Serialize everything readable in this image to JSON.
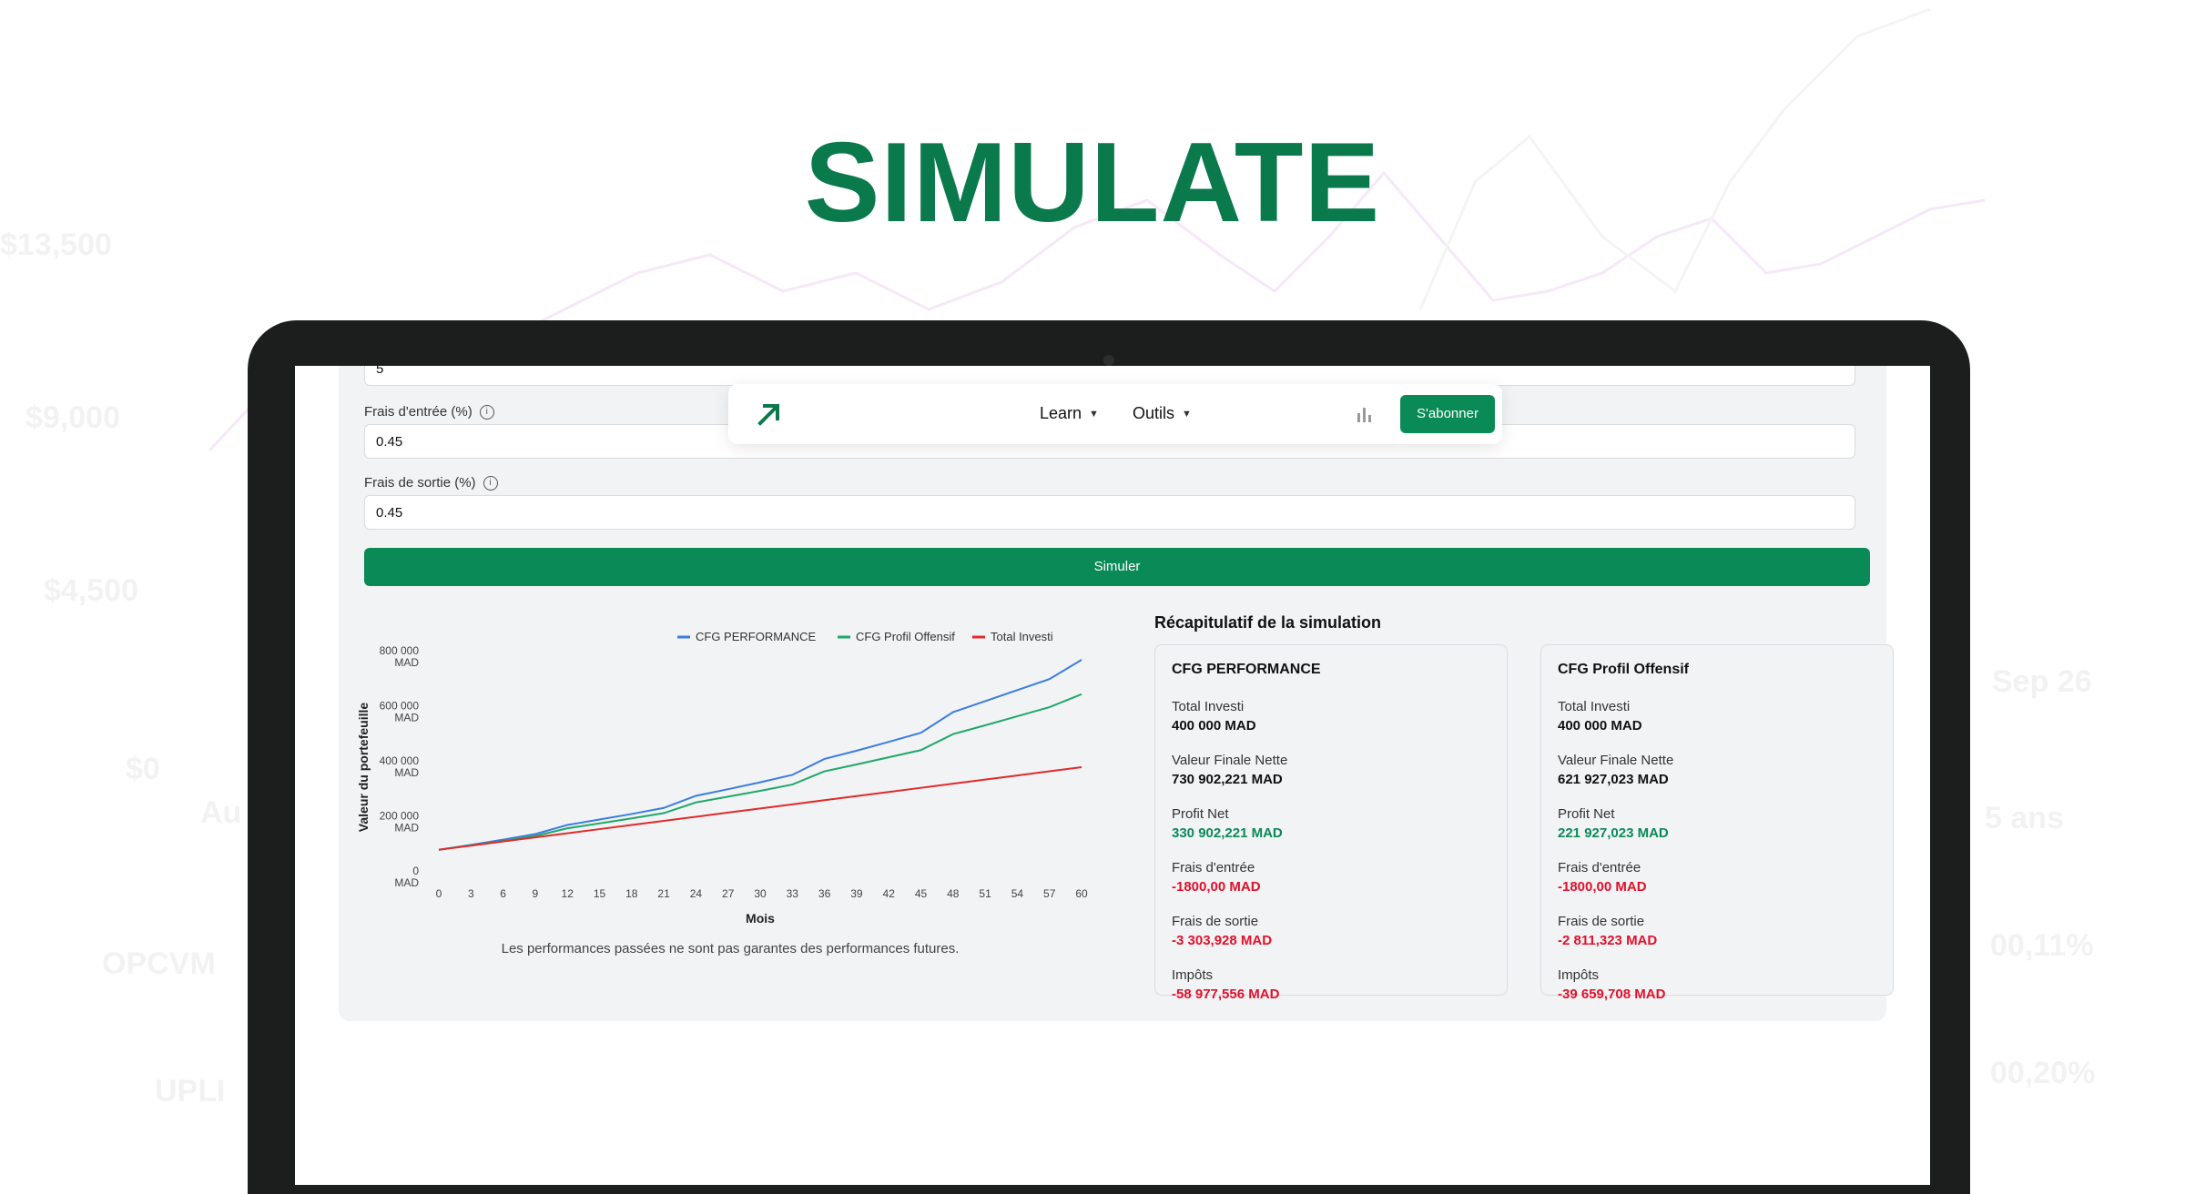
{
  "hero": {
    "title": "SIMULATE"
  },
  "background": {
    "labels": [
      "$13,500",
      "$9,000",
      "$4,500",
      "$0",
      "Au",
      "OPCVM",
      "UPLI",
      "Sep 26",
      "5 ans",
      "00,11%",
      "00,20%"
    ]
  },
  "navbar": {
    "logo_icon": "arrow-up-right-icon",
    "menu": [
      {
        "label": "Learn",
        "icon": "chevron-down-icon"
      },
      {
        "label": "Outils",
        "icon": "chevron-down-icon"
      }
    ],
    "chart_icon": "bar-chart-icon",
    "cta_label": "S'abonner"
  },
  "form": {
    "first_value": "5",
    "fields": [
      {
        "label": "Frais d'entrée (%)",
        "value": "0.45"
      },
      {
        "label": "Frais de sortie (%)",
        "value": "0.45"
      }
    ],
    "submit_label": "Simuler"
  },
  "colors": {
    "accent": "#0a8a57",
    "title": "#0a7a4c",
    "blue": "#3a7de0",
    "green": "#1fa86a",
    "red": "#e02b2b"
  },
  "chart_data": {
    "type": "line",
    "title": "",
    "xlabel": "Mois",
    "ylabel": "Valeur du portefeuille",
    "x": [
      0,
      3,
      6,
      9,
      12,
      15,
      18,
      21,
      24,
      27,
      30,
      33,
      36,
      39,
      42,
      45,
      48,
      51,
      54,
      57,
      60
    ],
    "x_ticks": [
      "0",
      "3",
      "6",
      "9",
      "12",
      "15",
      "18",
      "21",
      "24",
      "27",
      "30",
      "33",
      "36",
      "39",
      "42",
      "45",
      "48",
      "51",
      "54",
      "57",
      "60"
    ],
    "y_ticks": [
      {
        "value": 0,
        "label": "0 MAD"
      },
      {
        "value": 200000,
        "label": "200 000 MAD"
      },
      {
        "value": 400000,
        "label": "400 000 MAD"
      },
      {
        "value": 600000,
        "label": "600 000 MAD"
      },
      {
        "value": 800000,
        "label": "800 000 MAD"
      }
    ],
    "ylim": [
      0,
      800000
    ],
    "legend_position": "top-right",
    "series": [
      {
        "name": "CFG PERFORMANCE",
        "color": "#3a7de0",
        "values": [
          100000,
          118000,
          137000,
          157000,
          190000,
          210000,
          230000,
          252000,
          296000,
          320000,
          345000,
          372000,
          430000,
          460000,
          492000,
          525000,
          600000,
          640000,
          680000,
          720000,
          790000
        ]
      },
      {
        "name": "CFG Profil Offensif",
        "color": "#1fa86a",
        "values": [
          100000,
          116000,
          132000,
          150000,
          178000,
          196000,
          214000,
          233000,
          272000,
          293000,
          314000,
          337000,
          385000,
          410000,
          436000,
          462000,
          520000,
          552000,
          585000,
          618000,
          665000
        ]
      },
      {
        "name": "Total Investi",
        "color": "#e02b2b",
        "values": [
          100000,
          115000,
          130000,
          145000,
          160000,
          175000,
          190000,
          205000,
          220000,
          235000,
          250000,
          265000,
          280000,
          295000,
          310000,
          325000,
          340000,
          355000,
          370000,
          385000,
          400000
        ]
      }
    ]
  },
  "disclaimer": "Les performances passées ne sont pas garantes des performances futures.",
  "summary": {
    "title": "Récapitulatif de la simulation",
    "cards": [
      {
        "title": "CFG PERFORMANCE",
        "rows": [
          {
            "label": "Total Investi",
            "value": "400 000 MAD",
            "kind": "neutral"
          },
          {
            "label": "Valeur Finale Nette",
            "value": "730 902,221 MAD",
            "kind": "neutral"
          },
          {
            "label": "Profit Net",
            "value": "330 902,221 MAD",
            "kind": "pos"
          },
          {
            "label": "Frais d'entrée",
            "value": "-1800,00 MAD",
            "kind": "neg"
          },
          {
            "label": "Frais de sortie",
            "value": "-3 303,928 MAD",
            "kind": "neg"
          },
          {
            "label": "Impôts",
            "value": "-58 977,556 MAD",
            "kind": "neg"
          }
        ]
      },
      {
        "title": "CFG Profil Offensif",
        "rows": [
          {
            "label": "Total Investi",
            "value": "400 000 MAD",
            "kind": "neutral"
          },
          {
            "label": "Valeur Finale Nette",
            "value": "621 927,023 MAD",
            "kind": "neutral"
          },
          {
            "label": "Profit Net",
            "value": "221 927,023 MAD",
            "kind": "pos"
          },
          {
            "label": "Frais d'entrée",
            "value": "-1800,00 MAD",
            "kind": "neg"
          },
          {
            "label": "Frais de sortie",
            "value": "-2 811,323 MAD",
            "kind": "neg"
          },
          {
            "label": "Impôts",
            "value": "-39 659,708 MAD",
            "kind": "neg"
          }
        ]
      }
    ]
  }
}
